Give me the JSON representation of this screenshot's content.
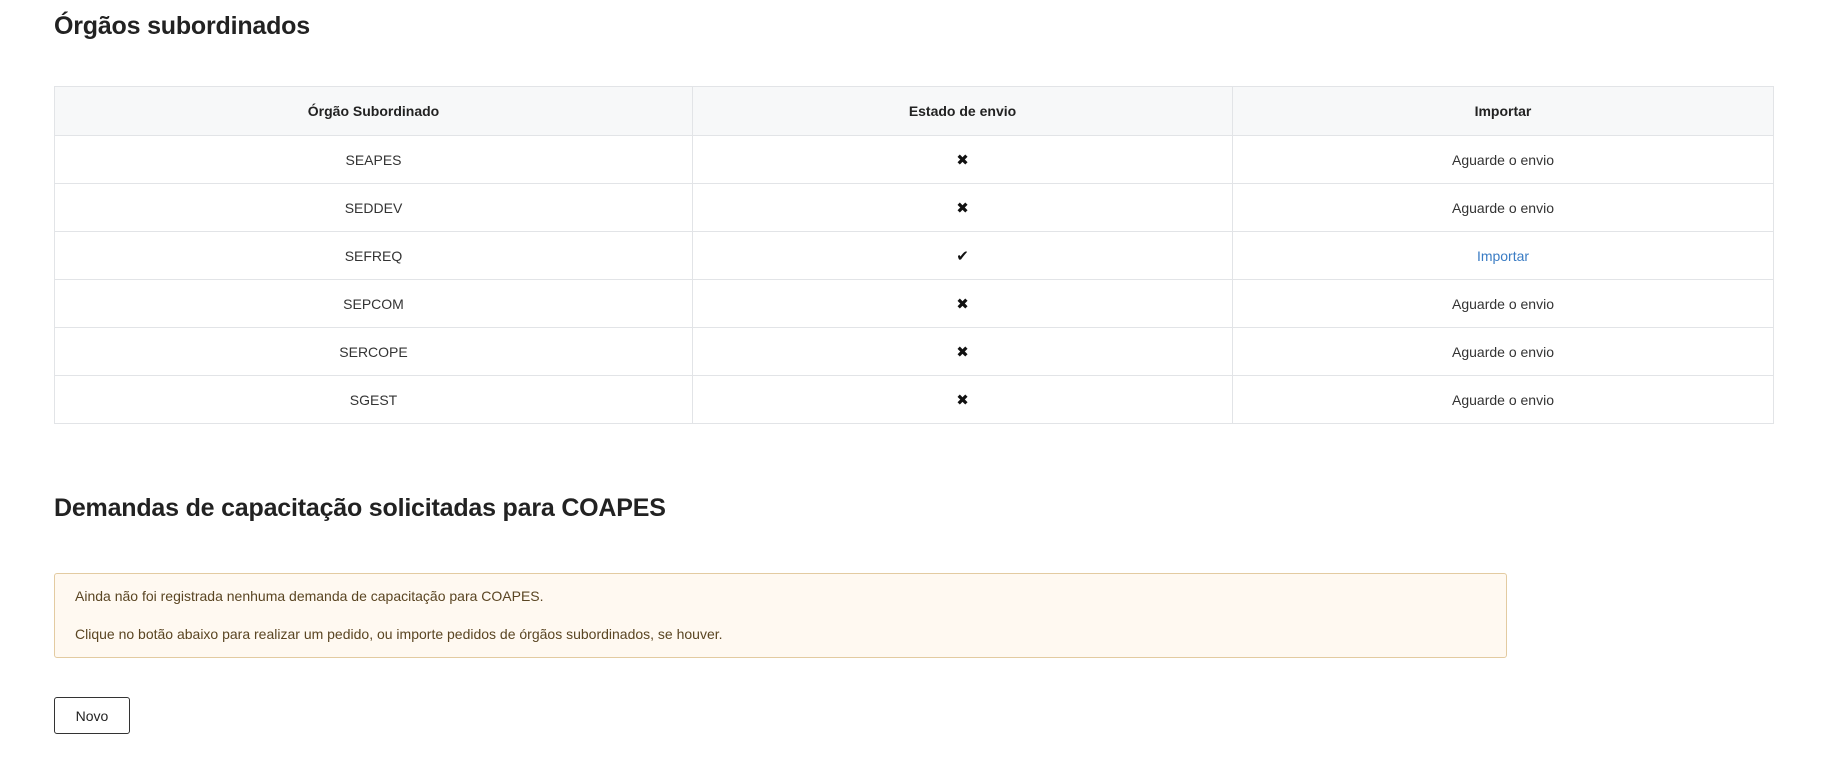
{
  "orgaos_section": {
    "title": "Órgãos subordinados",
    "columns": [
      "Órgão Subordinado",
      "Estado de envio",
      "Importar"
    ],
    "rows": [
      {
        "orgao": "SEAPES",
        "estado": "✖",
        "importar": "Aguarde o envio",
        "importar_is_link": false
      },
      {
        "orgao": "SEDDEV",
        "estado": "✖",
        "importar": "Aguarde o envio",
        "importar_is_link": false
      },
      {
        "orgao": "SEFREQ",
        "estado": "✔",
        "importar": "Importar",
        "importar_is_link": true
      },
      {
        "orgao": "SEPCOM",
        "estado": "✖",
        "importar": "Aguarde o envio",
        "importar_is_link": false
      },
      {
        "orgao": "SERCOPE",
        "estado": "✖",
        "importar": "Aguarde o envio",
        "importar_is_link": false
      },
      {
        "orgao": "SGEST",
        "estado": "✖",
        "importar": "Aguarde o envio",
        "importar_is_link": false
      }
    ]
  },
  "demandas_section": {
    "title": "Demandas de capacitação solicitadas para COAPES",
    "alert_line1": "Ainda não foi registrada nenhuma demanda de capacitação para COAPES.",
    "alert_line2": "Clique no botão abaixo para realizar um pedido, ou importe pedidos de órgãos subordinados, se houver.",
    "new_button_label": "Novo"
  },
  "colors": {
    "link": "#3a7cc4",
    "alert_bg": "#fff9f1",
    "alert_border": "#e3cba1",
    "alert_text": "#5a4522"
  }
}
